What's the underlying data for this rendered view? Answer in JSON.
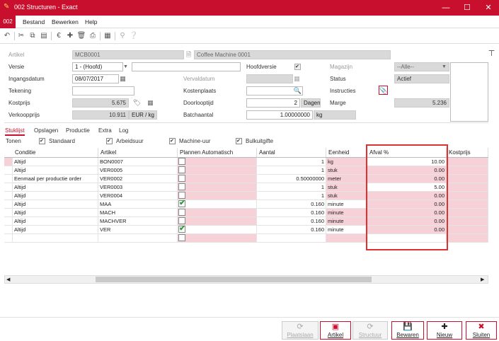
{
  "window": {
    "title": "002 Structuren - Exact",
    "minimize": "—",
    "maximize": "☐",
    "close": "✕"
  },
  "menu": {
    "company_code": "002",
    "items": [
      "Bestand",
      "Bewerken",
      "Help"
    ]
  },
  "toolbar": {
    "icons": [
      "undo-icon",
      "cut-icon",
      "copy-icon",
      "paste-icon",
      "euro-icon",
      "add-icon",
      "delete-icon",
      "print-icon",
      "table-icon",
      "zoom-icon",
      "help-icon"
    ]
  },
  "form": {
    "artikel_label": "Artikel",
    "artikel_code": "MCB0001",
    "artikel_desc": "Coffee Machine 0001",
    "versie_label": "Versie",
    "versie_value": "1 - (Hoofd)",
    "versie_extra": "",
    "hoofdversie_label": "Hoofdversie",
    "hoofdversie_checked": true,
    "magazijn_label": "Magazijn",
    "magazijn_value": "--Alle--",
    "ingangsdatum_label": "Ingangsdatum",
    "ingangsdatum_value": "08/07/2017",
    "vervaldatum_label": "Vervaldatum",
    "vervaldatum_value": "",
    "status_label": "Status",
    "status_value": "Actief",
    "tekening_label": "Tekening",
    "tekening_value": "",
    "kostenplaats_label": "Kostenplaats",
    "kostenplaats_value": "",
    "instructies_label": "Instructies",
    "kostprijs_label": "Kostprijs",
    "kostprijs_value": "5.675",
    "doorlooptijd_label": "Doorlooptijd",
    "doorlooptijd_value": "2",
    "doorlooptijd_unit": "Dagen",
    "marge_label": "Marge",
    "marge_value": "5.236",
    "verkoopprijs_label": "Verkoopprijs",
    "verkoopprijs_value": "10.911",
    "verkoopprijs_unit": "EUR / kg",
    "batchaantal_label": "Batchaantal",
    "batchaantal_value": "1.00000000",
    "batchaantal_unit": "kg"
  },
  "tabs": [
    "Stuklijst",
    "Opslagen",
    "Productie",
    "Extra",
    "Log"
  ],
  "tonen": {
    "label": "Tonen",
    "options": [
      {
        "label": "Standaard",
        "checked": true
      },
      {
        "label": "Arbeidsuur",
        "checked": true
      },
      {
        "label": "Machine-uur",
        "checked": true
      },
      {
        "label": "Bulkuitgifte",
        "checked": true
      }
    ]
  },
  "grid": {
    "columns": [
      "Conditie",
      "Artikel",
      "Plannen Automatisch",
      "Aantal",
      "Eenheid",
      "Afval %",
      "Kostprijs"
    ],
    "rows": [
      {
        "conditie": "Altijd",
        "artikel": "BON0007",
        "plannen": false,
        "aantal": "1",
        "eenheid": "kg",
        "afval": "10.00",
        "kostprijs": ""
      },
      {
        "conditie": "Altijd",
        "artikel": "VER0005",
        "plannen": false,
        "aantal": "1",
        "eenheid": "stuk",
        "afval": "0.00",
        "kostprijs": ""
      },
      {
        "conditie": "Eenmaal per productie order",
        "artikel": "VER0002",
        "plannen": false,
        "aantal": "0.50000000",
        "eenheid": "meter",
        "afval": "0.00",
        "kostprijs": ""
      },
      {
        "conditie": "Altijd",
        "artikel": "VER0003",
        "plannen": false,
        "aantal": "1",
        "eenheid": "stuk",
        "afval": "5.00",
        "kostprijs": ""
      },
      {
        "conditie": "Altijd",
        "artikel": "VER0004",
        "plannen": false,
        "aantal": "1",
        "eenheid": "stuk",
        "afval": "0.00",
        "kostprijs": ""
      },
      {
        "conditie": "Altijd",
        "artikel": "MAA",
        "plannen": true,
        "aantal": "0.160",
        "eenheid": "minute",
        "afval": "0.00",
        "kostprijs": ""
      },
      {
        "conditie": "Altijd",
        "artikel": "MACH",
        "plannen": false,
        "aantal": "0.160",
        "eenheid": "minute",
        "afval": "0.00",
        "kostprijs": ""
      },
      {
        "conditie": "Altijd",
        "artikel": "MACHVER",
        "plannen": false,
        "aantal": "0.160",
        "eenheid": "minute",
        "afval": "0.00",
        "kostprijs": ""
      },
      {
        "conditie": "Altijd",
        "artikel": "VER",
        "plannen": true,
        "aantal": "0.160",
        "eenheid": "minute",
        "afval": "0.00",
        "kostprijs": ""
      },
      {
        "conditie": "",
        "artikel": "",
        "plannen": false,
        "aantal": "",
        "eenheid": "",
        "afval": "",
        "kostprijs": ""
      }
    ]
  },
  "buttons": [
    {
      "label": "Plaatslaan",
      "icon": "refresh-icon",
      "enabled": false
    },
    {
      "label": "Artikel",
      "icon": "box-icon",
      "enabled": true
    },
    {
      "label": "Structuur",
      "icon": "structure-icon",
      "enabled": false
    },
    {
      "label": "Bewaren",
      "icon": "save-icon",
      "enabled": true
    },
    {
      "label": "Nieuw",
      "icon": "plus-icon",
      "enabled": true
    },
    {
      "label": "Sluiten",
      "icon": "close-icon",
      "enabled": true
    }
  ],
  "colors": {
    "brand": "#c8102e",
    "row_highlight": "#f6d1d7",
    "annotation": "#e03030"
  }
}
